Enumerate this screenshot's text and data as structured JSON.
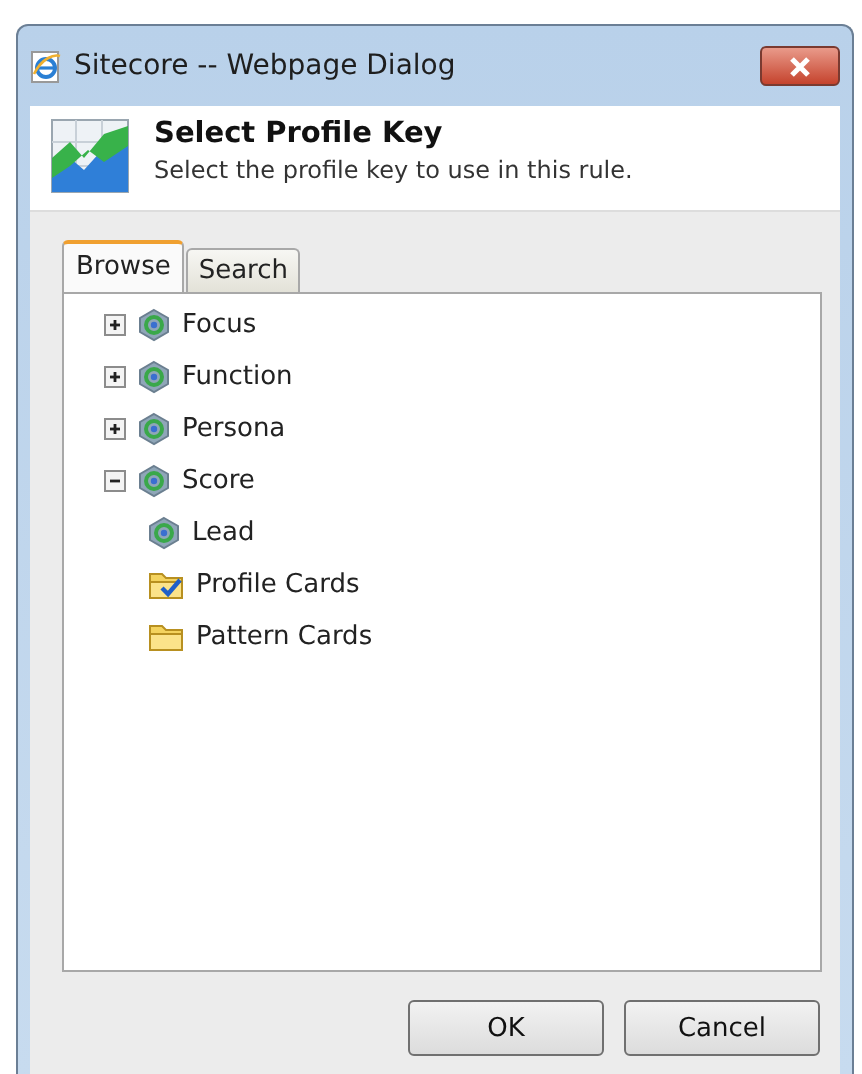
{
  "window": {
    "title": "Sitecore -- Webpage Dialog"
  },
  "header": {
    "title": "Select Profile Key",
    "subtitle": "Select the profile key to use in this rule."
  },
  "tabs": [
    {
      "label": "Browse",
      "selected": true
    },
    {
      "label": "Search",
      "selected": false
    }
  ],
  "tree": [
    {
      "label": "Focus",
      "kind": "profile",
      "expanded": false
    },
    {
      "label": "Function",
      "kind": "profile",
      "expanded": false
    },
    {
      "label": "Persona",
      "kind": "profile",
      "expanded": false
    },
    {
      "label": "Score",
      "kind": "profile",
      "expanded": true,
      "children": [
        {
          "label": "Lead",
          "kind": "profile"
        },
        {
          "label": "Profile Cards",
          "kind": "folder-checked"
        },
        {
          "label": "Pattern Cards",
          "kind": "folder"
        }
      ]
    }
  ],
  "buttons": [
    "OK",
    "Cancel"
  ]
}
